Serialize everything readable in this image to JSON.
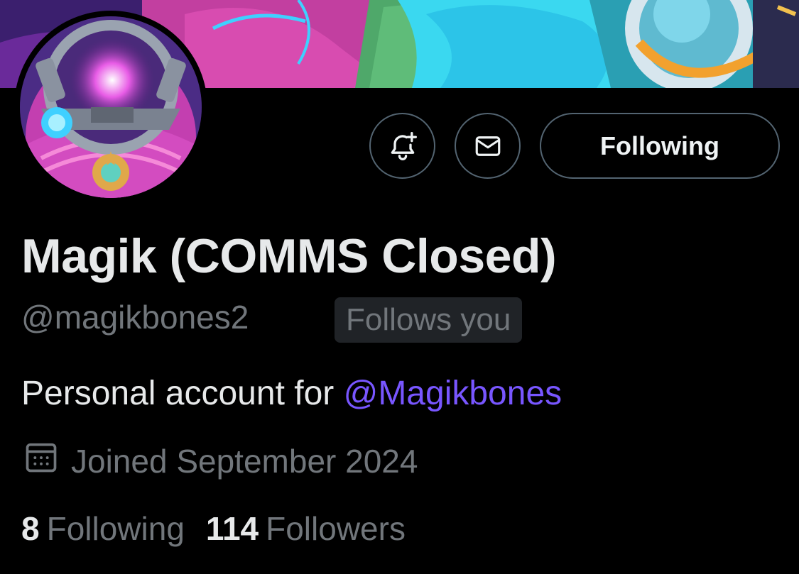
{
  "profile": {
    "display_name": "Magik (COMMS Closed)",
    "handle": "@magikbones2",
    "follows_you_badge": "Follows you",
    "bio_text": "Personal account for ",
    "bio_mention": "@Magikbones",
    "joined": "Joined September 2024"
  },
  "actions": {
    "following_label": "Following"
  },
  "stats": {
    "following_count": "8",
    "following_label": "Following",
    "followers_count": "114",
    "followers_label": "Followers"
  },
  "icons": {
    "notify": "bell-plus-icon",
    "message": "envelope-icon",
    "joined": "calendar-icon"
  },
  "colors": {
    "background": "#000000",
    "text_primary": "#e7e9ea",
    "text_secondary": "#71767b",
    "mention": "#7856ff",
    "badge_bg": "#202327",
    "button_border": "#536471"
  }
}
